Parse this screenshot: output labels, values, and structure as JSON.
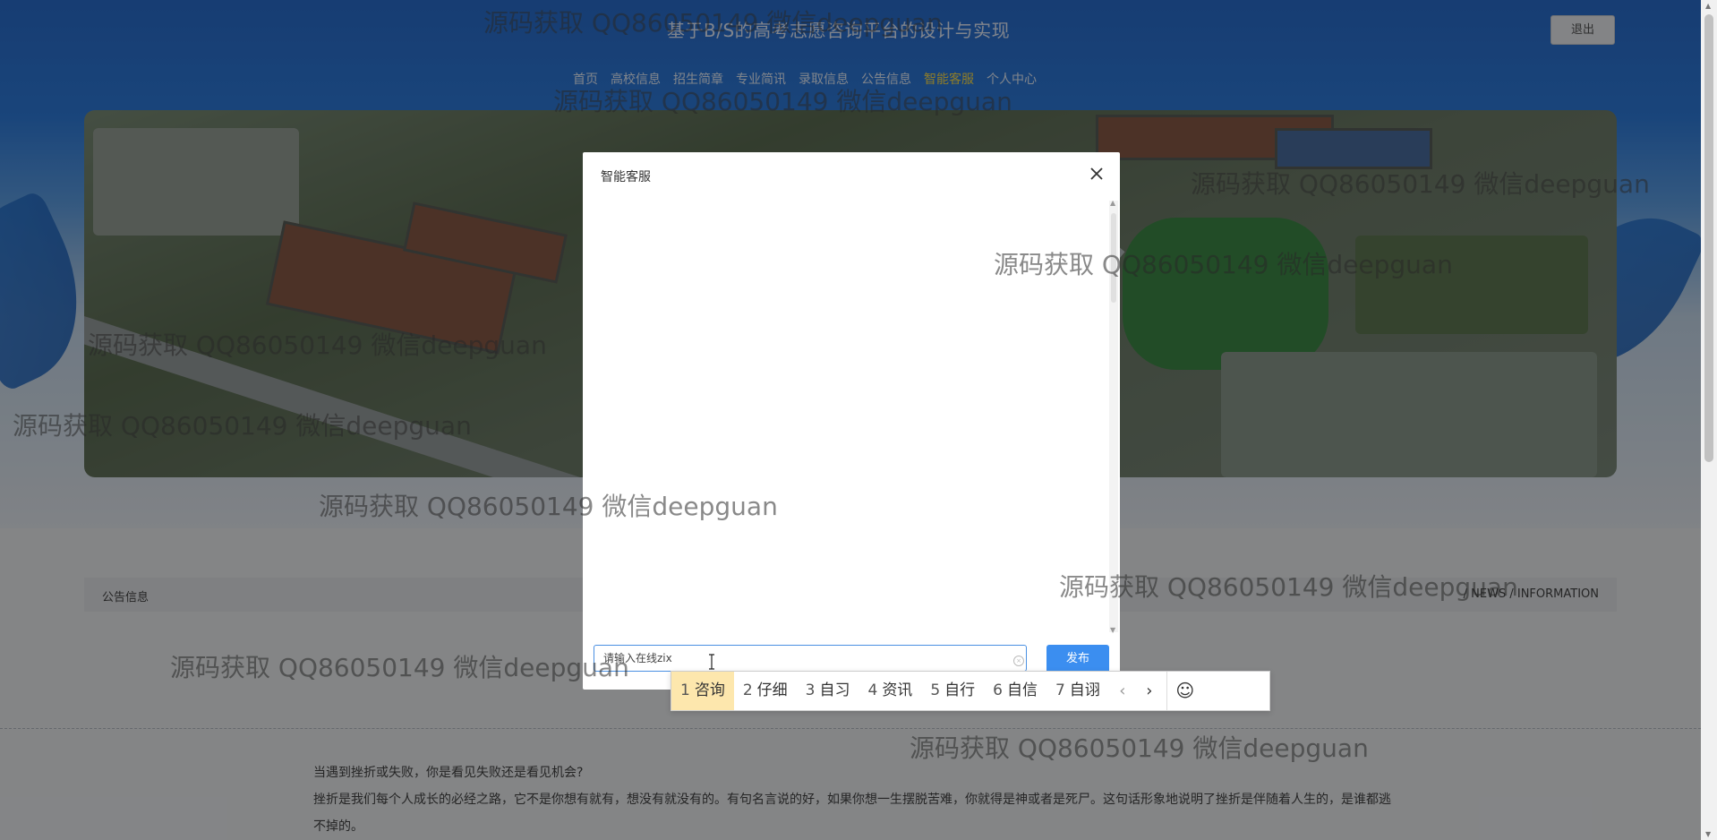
{
  "header": {
    "site_title": "基于B/S的高考志愿咨询平台的设计与实现",
    "logout_label": "退出"
  },
  "nav": {
    "items": [
      {
        "label": "首页"
      },
      {
        "label": "高校信息"
      },
      {
        "label": "招生简章"
      },
      {
        "label": "专业简讯"
      },
      {
        "label": "录取信息"
      },
      {
        "label": "公告信息"
      },
      {
        "label": "智能客服",
        "active": true
      },
      {
        "label": "个人中心"
      }
    ]
  },
  "notice": {
    "title": "公告信息",
    "english": "/ NEWS / INFORMATION"
  },
  "article": {
    "heading": "当遇到挫折或失败，你是看见失败还是看见机会?",
    "body": "挫折是我们每个人成长的必经之路，它不是你想有就有，想没有就没有的。有句名言说的好，如果你想一生摆脱苦难，你就得是神或者是死尸。这句话形象地说明了挫折是伴随着人生的，是谁都逃不掉的。"
  },
  "modal": {
    "title": "智能客服",
    "input_value": "请输入在线zix",
    "send_label": "发布"
  },
  "ime": {
    "candidates": [
      {
        "num": "1",
        "text": "咨询",
        "selected": true
      },
      {
        "num": "2",
        "text": "仔细"
      },
      {
        "num": "3",
        "text": "自习"
      },
      {
        "num": "4",
        "text": "资讯"
      },
      {
        "num": "5",
        "text": "自行"
      },
      {
        "num": "6",
        "text": "自信"
      },
      {
        "num": "7",
        "text": "自诩"
      }
    ]
  },
  "watermark": "源码获取 QQ86050149 微信deepguan",
  "colors": {
    "nav_active": "#ffe14d",
    "send_button": "#3b8ef0",
    "ime_selected": "#fde7ad"
  }
}
